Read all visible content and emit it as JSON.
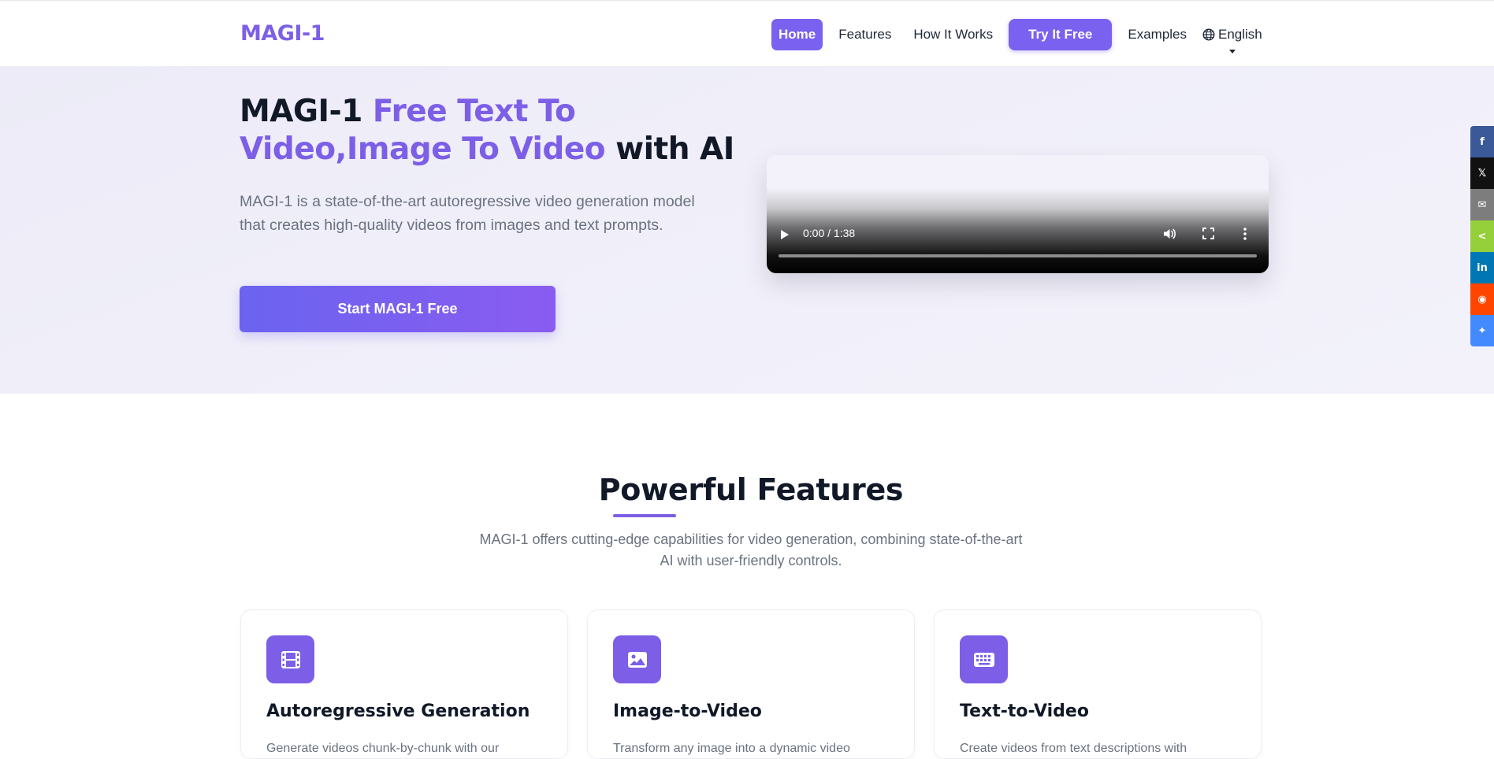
{
  "brand": {
    "logo": "MAGI-1",
    "accent": "#7c5fe6"
  },
  "nav": {
    "home": "Home",
    "features": "Features",
    "how_it_works": "How It Works",
    "try_free": "Try It Free",
    "examples": "Examples",
    "language": "English"
  },
  "hero": {
    "title_part1": "MAGI-1 ",
    "title_accent": "Free Text To Video,Image To Video",
    "title_part2": " with AI",
    "description": "MAGI-1 is a state-of-the-art autoregressive video generation model that creates high-quality videos from images and text prompts.",
    "cta": "Start MAGI-1 Free"
  },
  "video": {
    "time": "0:00 / 1:38",
    "progress": 0
  },
  "share": [
    {
      "icon": "facebook-icon",
      "color": "#3b5998",
      "glyph": "f"
    },
    {
      "icon": "x-icon",
      "color": "#111111",
      "glyph": "𝕏"
    },
    {
      "icon": "email-icon",
      "color": "#7d7d7d",
      "glyph": "✉"
    },
    {
      "icon": "share-icon",
      "color": "#95d03a",
      "glyph": "<"
    },
    {
      "icon": "linkedin-icon",
      "color": "#0077b5",
      "glyph": "in"
    },
    {
      "icon": "reddit-icon",
      "color": "#ff4500",
      "glyph": "◉"
    },
    {
      "icon": "messenger-icon",
      "color": "#448aff",
      "glyph": "✦"
    }
  ],
  "features": {
    "title": "Powerful Features",
    "subtitle": "MAGI-1 offers cutting-edge capabilities for video generation, combining state-of-the-art AI with user-friendly controls.",
    "cards": [
      {
        "icon": "film-icon",
        "title": "Autoregressive Generation",
        "text": "Generate videos chunk-by-chunk with our"
      },
      {
        "icon": "image-icon",
        "title": "Image-to-Video",
        "text": "Transform any image into a dynamic video"
      },
      {
        "icon": "keyboard-icon",
        "title": "Text-to-Video",
        "text": "Create videos from text descriptions with"
      }
    ]
  }
}
